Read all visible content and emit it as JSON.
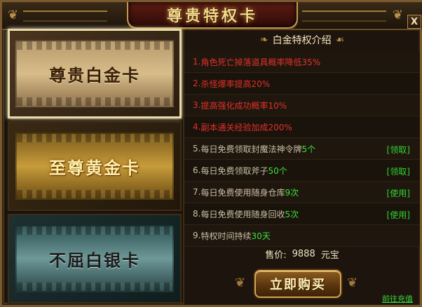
{
  "window": {
    "title": "尊贵特权卡",
    "close_label": "X"
  },
  "cards": [
    {
      "label": "尊贵白金卡",
      "selected": true
    },
    {
      "label": "至尊黄金卡",
      "selected": false
    },
    {
      "label": "不屈白银卡",
      "selected": false
    }
  ],
  "panel": {
    "title": "白金特权介绍",
    "benefits": [
      {
        "num": "1.",
        "text": "角色死亡掉落道具概率降低35%",
        "color": "red"
      },
      {
        "num": "2.",
        "text": "杀怪爆率提高20%",
        "color": "red"
      },
      {
        "num": "3.",
        "text": "提高强化成功概率10%",
        "color": "red"
      },
      {
        "num": "4.",
        "text": "副本通关经验加成200%",
        "color": "red"
      },
      {
        "num": "5.",
        "text": "每日免费领取封魔法神令牌",
        "value": "5个",
        "action": "[领取]"
      },
      {
        "num": "6.",
        "text": "每日免费领取斧子",
        "value": "50个",
        "action": "[领取]"
      },
      {
        "num": "7.",
        "text": "每日免费使用随身仓库",
        "value": "9次",
        "action": "[使用]"
      },
      {
        "num": "8.",
        "text": "每日免费使用随身回收",
        "value": "5次",
        "action": "[使用]"
      },
      {
        "num": "9.",
        "text": "特权时间持续",
        "value": "30天"
      }
    ],
    "price": {
      "label": "售价:",
      "amount": "9888",
      "unit": "元宝"
    },
    "buy_label": "立即购买",
    "recharge_label": "前往充值"
  }
}
